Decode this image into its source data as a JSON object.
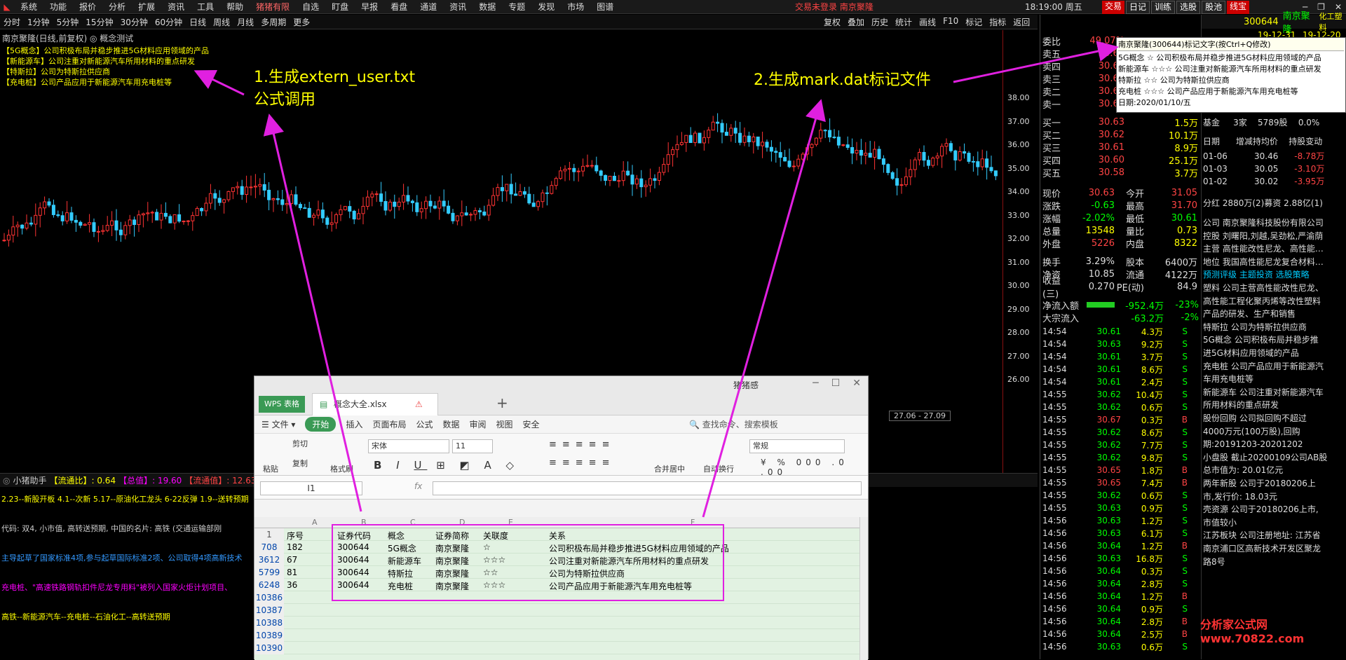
{
  "topbar": {
    "menu": [
      "系统",
      "功能",
      "报价",
      "分析",
      "扩展",
      "资讯",
      "工具",
      "帮助",
      "猪猪有限",
      "自选",
      "盯盘",
      "早报",
      "看盘",
      "通道",
      "资讯",
      "数据",
      "专题",
      "发现",
      "市场",
      "图谱"
    ],
    "status": "交易未登录",
    "stock": "南京聚隆",
    "time": "18:19:00",
    "weekday": "周五",
    "btns": [
      "交易",
      "日记",
      "训练",
      "选股",
      "股池",
      "线宝"
    ]
  },
  "periods": [
    "分时",
    "1分钟",
    "5分钟",
    "15分钟",
    "30分钟",
    "60分钟",
    "日线",
    "周线",
    "月线",
    "多周期",
    "更多"
  ],
  "chart_tools": [
    "复权",
    "叠加",
    "历史",
    "统计",
    "画线",
    "F10",
    "标记",
    "指标",
    "返回"
  ],
  "chart": {
    "title": "南京聚隆(日线,前复权) ◎ 概念测试",
    "concepts": [
      "【5G概念】公司积极布局并稳步推进5G材料应用领域的产品",
      "【新能源车】公司注重对新能源汽车所用材料的重点研发",
      "【特斯拉】公司为特斯拉供应商",
      "【充电桩】公司产品应用于新能源汽车用充电桩等"
    ],
    "prices": [
      "38.00",
      "37.00",
      "36.00",
      "35.00",
      "34.00",
      "33.00",
      "32.00",
      "31.00",
      "30.00",
      "29.00",
      "28.00",
      "27.00",
      "26.00"
    ],
    "date_label": "27.06 - 27.09",
    "anno1": "1.生成extern_user.txt",
    "anno1b": "公式调用",
    "anno2": "2.生成mark.dat标记文件"
  },
  "assist": {
    "name": "小猪助手",
    "l1": "【流通比】: 0.64",
    "l2": "【总值】: 19.60",
    "l3": "【流通值】: 12.63"
  },
  "lower": [
    "2.23--新股开板 4.1--次新 5.17--原油化工龙头 6-22反弹 1.9--送转预期",
    "代码: 双4, 小市值, 高转送预期, 中国的名片: 高铁 (交通运输部刚",
    "主导起草了国家标准4项,参与起草国际标准2项、公司取得4项高新技术",
    "充电桩、\"高速铁路钢轨扣件尼龙专用料\"被列入国家火炬计划项目、",
    "高铁--新能源汽车--充电桩--石油化工--高转送预期"
  ],
  "quote": {
    "weibi_label": "委比",
    "weibi": "49.07%",
    "sells": [
      [
        "卖五",
        "30.64"
      ],
      [
        "卖四",
        "30.66"
      ],
      [
        "卖三",
        "30.67"
      ],
      [
        "卖二",
        "30.65"
      ],
      [
        "卖一",
        "30.64"
      ]
    ],
    "buys": [
      [
        "买一",
        "30.63",
        "1.5万"
      ],
      [
        "买二",
        "30.62",
        "10.1万"
      ],
      [
        "买三",
        "30.61",
        "8.9万"
      ],
      [
        "买四",
        "30.60",
        "25.1万"
      ],
      [
        "买五",
        "30.58",
        "3.7万"
      ]
    ],
    "stats": [
      [
        "现价",
        "30.63",
        "今开",
        "31.05"
      ],
      [
        "涨跌",
        "-0.63",
        "最高",
        "31.70"
      ],
      [
        "涨幅",
        "-2.02%",
        "最低",
        "30.61"
      ],
      [
        "总量",
        "13548",
        "量比",
        "0.73"
      ],
      [
        "外盘",
        "5226",
        "内盘",
        "8322"
      ],
      [
        "换手",
        "3.29%",
        "股本",
        "6400万"
      ],
      [
        "净资",
        "10.85",
        "流通",
        "4122万"
      ],
      [
        "收益(三)",
        "0.270",
        "PE(动)",
        "84.9"
      ]
    ],
    "flow": [
      [
        "净流入额",
        "-952.4万",
        "-23%"
      ],
      [
        "大宗流入",
        "-63.2万",
        "-2%"
      ]
    ],
    "ticks": [
      [
        "14:54",
        "30.61",
        "4.3万",
        "S"
      ],
      [
        "14:54",
        "30.63",
        "9.2万",
        "S"
      ],
      [
        "14:54",
        "30.61",
        "3.7万",
        "S"
      ],
      [
        "14:54",
        "30.61",
        "8.6万",
        "S"
      ],
      [
        "14:54",
        "30.61",
        "2.4万",
        "S"
      ],
      [
        "14:55",
        "30.62",
        "10.4万",
        "S"
      ],
      [
        "14:55",
        "30.62",
        "0.6万",
        "S"
      ],
      [
        "14:55",
        "30.67",
        "0.3万",
        "B"
      ],
      [
        "14:55",
        "30.62",
        "8.6万",
        "S"
      ],
      [
        "14:55",
        "30.62",
        "7.7万",
        "S"
      ],
      [
        "14:55",
        "30.62",
        "9.8万",
        "S"
      ],
      [
        "14:55",
        "30.65",
        "1.8万",
        "B"
      ],
      [
        "14:55",
        "30.65",
        "7.4万",
        "B"
      ],
      [
        "14:55",
        "30.62",
        "0.6万",
        "S"
      ],
      [
        "14:55",
        "30.63",
        "0.9万",
        "S"
      ],
      [
        "14:56",
        "30.63",
        "1.2万",
        "S"
      ],
      [
        "14:56",
        "30.63",
        "6.1万",
        "S"
      ],
      [
        "14:56",
        "30.64",
        "1.2万",
        "B"
      ],
      [
        "14:56",
        "30.63",
        "16.8万",
        "S"
      ],
      [
        "14:56",
        "30.64",
        "0.3万",
        "S"
      ],
      [
        "14:56",
        "30.64",
        "2.8万",
        "S"
      ],
      [
        "14:56",
        "30.64",
        "1.2万",
        "B"
      ],
      [
        "14:56",
        "30.64",
        "0.9万",
        "S"
      ],
      [
        "14:56",
        "30.64",
        "2.8万",
        "B"
      ],
      [
        "14:56",
        "30.64",
        "2.5万",
        "B"
      ],
      [
        "14:56",
        "30.63",
        "0.6万",
        "S"
      ]
    ]
  },
  "info": {
    "code": "300644",
    "name": "南京聚隆",
    "sector": "化工塑料",
    "dates": [
      "19-12-31",
      "19-12-20"
    ],
    "fund": [
      "基金",
      "3家",
      "5789股",
      "0.0%"
    ],
    "holders_hdr": [
      "日期",
      "增减持均价",
      "持股变动"
    ],
    "holders": [
      [
        "01-06",
        "30.46",
        "-8.78万"
      ],
      [
        "01-03",
        "30.05",
        "-3.10万"
      ],
      [
        "01-02",
        "30.02",
        "-3.95万"
      ]
    ],
    "fenhong": "分红 2880万(2)募资 2.88亿(1)",
    "lines": [
      "公司 南京聚隆科技股份有限公司",
      "控股 刘曙阳,刘越,吴劲松,严渝荫",
      "主营 高性能改性尼龙、高性能…",
      "地位 我国高性能尼龙复合材料…",
      "预测评级 主题投资 选股策略",
      "塑料 公司主营高性能改性尼龙、",
      "高性能工程化聚丙烯等改性塑料",
      "产品的研发、生产和销售",
      "特斯拉 公司为特斯拉供应商",
      "5G概念 公司积极布局并稳步推",
      "进5G材料应用领域的产品",
      "充电桩 公司产品应用于新能源汽",
      "车用充电桩等",
      "新能源车 公司注重对新能源汽车",
      "所用材料的重点研发",
      "股份回购 公司拟回购不超过",
      "4000万元(100万股),回购",
      "期:20191203-20201202",
      "小盘股 截止20200109公司AB股",
      "总市值为: 20.01亿元",
      "两年新股 公司于20180206上",
      "市,发行价: 18.03元",
      "壳资源 公司于20180206上市,",
      "市值较小",
      "江苏板块 公司注册地址: 江苏省",
      "南京浦口区高新技术开发区聚龙",
      "路8号"
    ]
  },
  "tooltip": {
    "title": "南京聚隆(300644)标记文字(按Ctrl+Q修改)",
    "lines": [
      "5G概念 ☆ 公司积极布局并稳步推进5G材料应用领域的产品",
      "新能源车 ☆☆☆ 公司注重对新能源汽车所用材料的重点研发",
      "特斯拉 ☆☆ 公司为特斯拉供应商",
      "充电桩 ☆☆☆ 公司产品应用于新能源汽车用充电桩等",
      "日期:2020/01/10/五"
    ]
  },
  "wps": {
    "app": "WPS 表格",
    "file": "概念大全.xlsx",
    "user": "猪猪感",
    "tabs": [
      "开始",
      "插入",
      "页面布局",
      "公式",
      "数据",
      "审阅",
      "视图",
      "安全"
    ],
    "search": "查找命令、搜索模板",
    "font": "宋体",
    "size": "11",
    "numfmt": "常规",
    "tools": [
      "粘贴",
      "剪切",
      "复制",
      "格式刷",
      "合并居中",
      "自动换行"
    ],
    "cell": "I1",
    "fx": "fx",
    "cols": [
      "A",
      "B",
      "C",
      "D",
      "E",
      "F"
    ],
    "header": [
      "序号",
      "证券代码",
      "概念",
      "证券简称",
      "关联度",
      "关系"
    ],
    "rows": [
      {
        "rn": "708",
        "a": "182",
        "b": "300644",
        "c": "5G概念",
        "d": "南京聚隆",
        "e": "☆",
        "f": "公司积极布局并稳步推进5G材料应用领域的产品"
      },
      {
        "rn": "3612",
        "a": "67",
        "b": "300644",
        "c": "新能源车",
        "d": "南京聚隆",
        "e": "☆☆☆",
        "f": "公司注重对新能源汽车所用材料的重点研发"
      },
      {
        "rn": "5799",
        "a": "81",
        "b": "300644",
        "c": "特斯拉",
        "d": "南京聚隆",
        "e": "☆☆",
        "f": "公司为特斯拉供应商"
      },
      {
        "rn": "6248",
        "a": "36",
        "b": "300644",
        "c": "充电桩",
        "d": "南京聚隆",
        "e": "☆☆☆",
        "f": "公司产品应用于新能源汽车用充电桩等"
      }
    ],
    "empty_rows": [
      "10386",
      "10387",
      "10388",
      "10389",
      "10390"
    ]
  },
  "watermark": "分析家公式网 www.70822.com"
}
